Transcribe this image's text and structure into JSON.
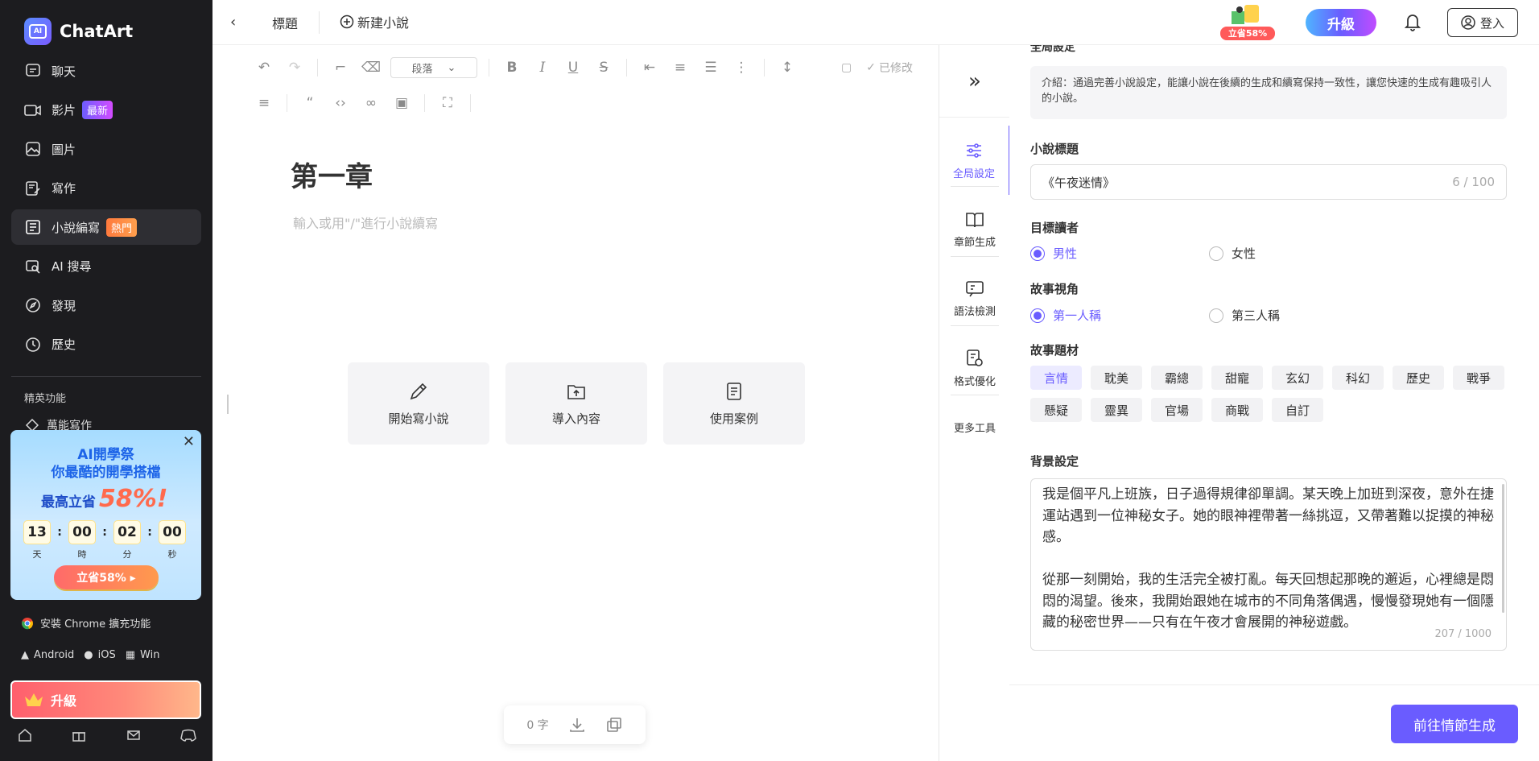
{
  "app": {
    "name": "ChatArt",
    "logo_mark": "AI"
  },
  "sidebar": {
    "items": [
      {
        "label": "聊天",
        "icon": "chat-icon"
      },
      {
        "label": "影片",
        "icon": "video-icon",
        "badge": "最新"
      },
      {
        "label": "圖片",
        "icon": "image-icon"
      },
      {
        "label": "寫作",
        "icon": "writing-icon"
      },
      {
        "label": "小說編寫",
        "icon": "novel-icon",
        "badge": "熱門",
        "active": true
      },
      {
        "label": "AI 搜尋",
        "icon": "ai-search-icon"
      },
      {
        "label": "發現",
        "icon": "compass-icon"
      },
      {
        "label": "歷史",
        "icon": "history-icon"
      }
    ],
    "section_label": "精英功能",
    "sub_item": "萬能寫作",
    "promo": {
      "line1": "AI開學祭",
      "line2": "你最酷的開學搭檔",
      "save_prefix": "最高立省",
      "save_value": "58%!",
      "timer": {
        "days": "13",
        "hours": "00",
        "minutes": "02",
        "seconds": "00"
      },
      "timer_labels": {
        "days": "天",
        "hours": "時",
        "minutes": "分",
        "seconds": "秒"
      },
      "button": "立省58% ▸"
    },
    "chrome_ext": "安裝 Chrome 擴充功能",
    "platforms": {
      "android": "Android",
      "ios": "iOS",
      "win": "Win"
    },
    "upgrade": "升級"
  },
  "topbar": {
    "title_tab": "標題",
    "new_novel": "新建小說",
    "gift_label": "立省58%",
    "upgrade": "升級",
    "login": "登入"
  },
  "editor": {
    "toolbar": {
      "paragraph_select": "段落",
      "saved_status": "已修改"
    },
    "chapter_title": "第一章",
    "placeholder": "輸入或用\"/\"進行小說續寫",
    "actions": [
      {
        "label": "開始寫小說",
        "icon": "pencil-icon"
      },
      {
        "label": "導入內容",
        "icon": "upload-folder-icon"
      },
      {
        "label": "使用案例",
        "icon": "document-icon"
      }
    ],
    "word_count": "0 字"
  },
  "tool_rail": {
    "items": [
      {
        "label": "全局設定",
        "icon": "sliders-icon",
        "active": true
      },
      {
        "label": "章節生成",
        "icon": "book-icon"
      },
      {
        "label": "語法檢測",
        "icon": "grammar-check-icon"
      },
      {
        "label": "格式優化",
        "icon": "format-icon"
      },
      {
        "label": "更多工具",
        "icon": ""
      }
    ]
  },
  "settings": {
    "heading": "全局設定",
    "intro": "介紹：通過完善小說設定，能讓小說在後續的生成和續寫保持一致性，讓您快速的生成有趣吸引人的小說。",
    "novel_title": {
      "label": "小說標題",
      "value": "《午夜迷情》",
      "count": "6 / 100"
    },
    "audience": {
      "label": "目標讀者",
      "options": [
        "男性",
        "女性"
      ],
      "selected": 0
    },
    "perspective": {
      "label": "故事視角",
      "options": [
        "第一人稱",
        "第三人稱"
      ],
      "selected": 0
    },
    "genre": {
      "label": "故事題材",
      "options": [
        "言情",
        "耽美",
        "霸總",
        "甜寵",
        "玄幻",
        "科幻",
        "歷史",
        "戰爭",
        "懸疑",
        "靈異",
        "官場",
        "商戰",
        "自訂"
      ],
      "selected": 0
    },
    "background": {
      "label": "背景設定",
      "text": "我是個平凡上班族，日子過得規律卻單調。某天晚上加班到深夜，意外在捷運站遇到一位神秘女子。她的眼神裡帶著一絲挑逗，又帶著難以捉摸的神秘感。\n\n從那一刻開始，我的生活完全被打亂。每天回想起那晚的邂逅，心裡總是悶悶的渴望。後來，我開始跟她在城市的不同角落偶遇，慢慢發現她有一個隱藏的秘密世界——只有在午夜才會展開的神秘遊戲。",
      "count": "207 / 1000"
    },
    "generate_button": "前往情節生成"
  },
  "colors": {
    "accent": "#6a5cff",
    "sidebar_bg": "#1c1c1f",
    "hot_badge": "#ff7a3d"
  }
}
